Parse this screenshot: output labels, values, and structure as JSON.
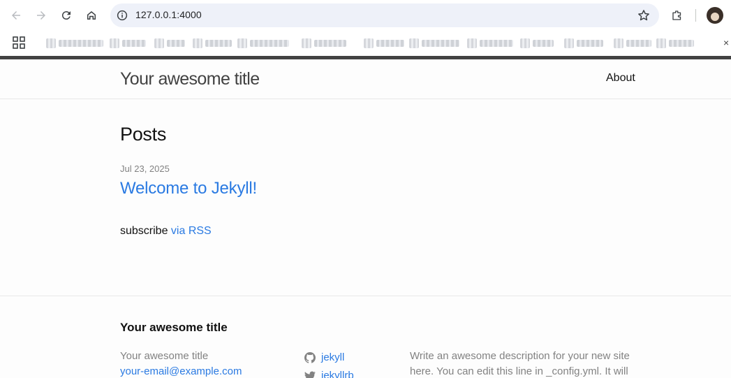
{
  "browser": {
    "url": "127.0.0.1:4000",
    "icons": [
      "back-icon",
      "forward-icon",
      "reload-icon",
      "home-icon",
      "site-info-icon",
      "bookmark-star-icon",
      "extensions-icon",
      "profile-avatar",
      "apps-grid-icon"
    ],
    "bookmarks_close": "×"
  },
  "site": {
    "title": "Your awesome title",
    "nav": {
      "about": "About"
    }
  },
  "main": {
    "heading": "Posts",
    "posts": [
      {
        "date": "Jul 23, 2025",
        "title": "Welcome to Jekyll!"
      }
    ],
    "subscribe_prefix": "subscribe ",
    "subscribe_link": "via RSS"
  },
  "footer": {
    "heading": "Your awesome title",
    "name": "Your awesome title",
    "email": "your-email@example.com",
    "github": "jekyll",
    "twitter": "jekyllrb",
    "description": "Write an awesome description for your new site here. You can edit this line in _config.yml. It will"
  },
  "colors": {
    "link": "#2a7ae2",
    "text": "#111111",
    "muted": "#828282",
    "topbar": "#424242"
  }
}
